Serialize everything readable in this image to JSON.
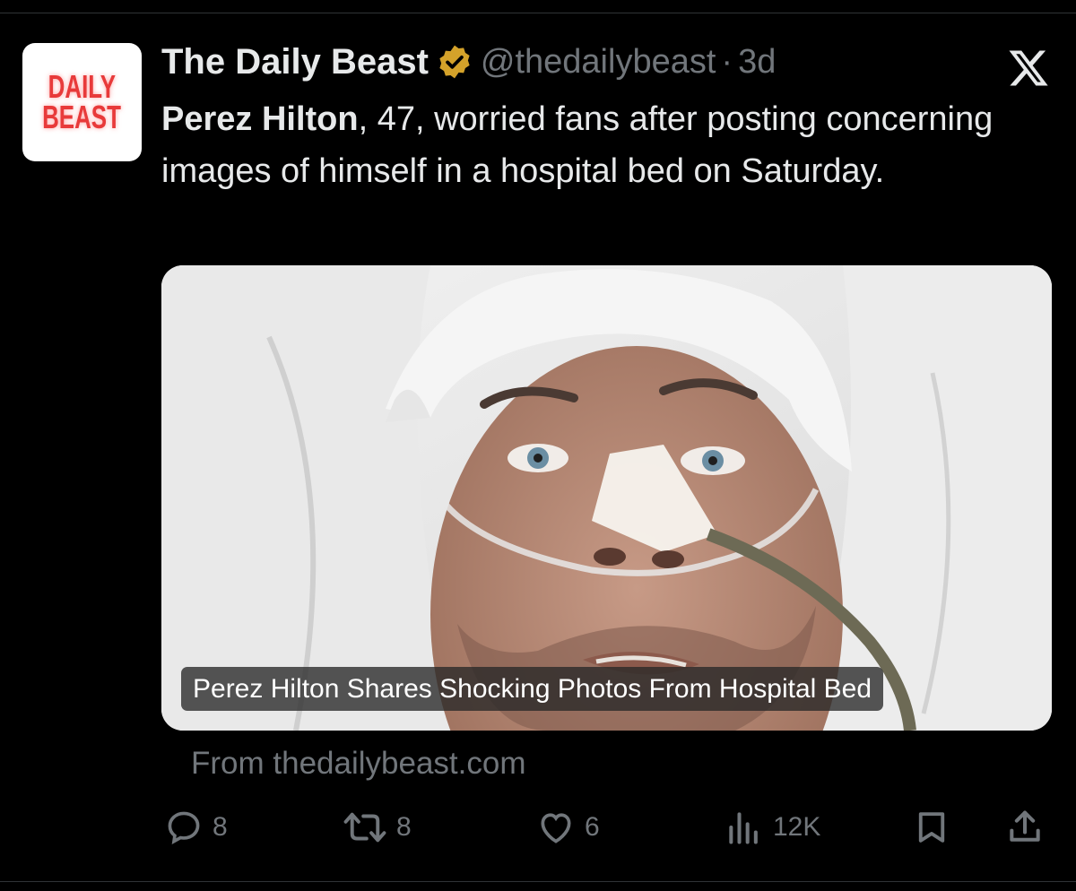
{
  "tweet": {
    "display_name": "The Daily Beast",
    "handle": "@thedailybeast",
    "separator": "·",
    "time": "3d",
    "text_bold": "Perez Hilton",
    "text_rest": ", 47, worried fans after posting concerning images of himself in a hospital bed on Saturday.",
    "avatar_line1": "DAILY",
    "avatar_line2": "BEAST",
    "verified_color": "#d4a22a"
  },
  "card": {
    "caption": "Perez Hilton Shares Shocking Photos From Hospital Bed",
    "source": "From thedailybeast.com",
    "image_icon": "hospital-photo"
  },
  "actions": {
    "replies": "8",
    "reposts": "8",
    "likes": "6",
    "views": "12K"
  },
  "colors": {
    "background": "#000000",
    "text": "#e7e9ea",
    "secondary": "#71767b"
  }
}
